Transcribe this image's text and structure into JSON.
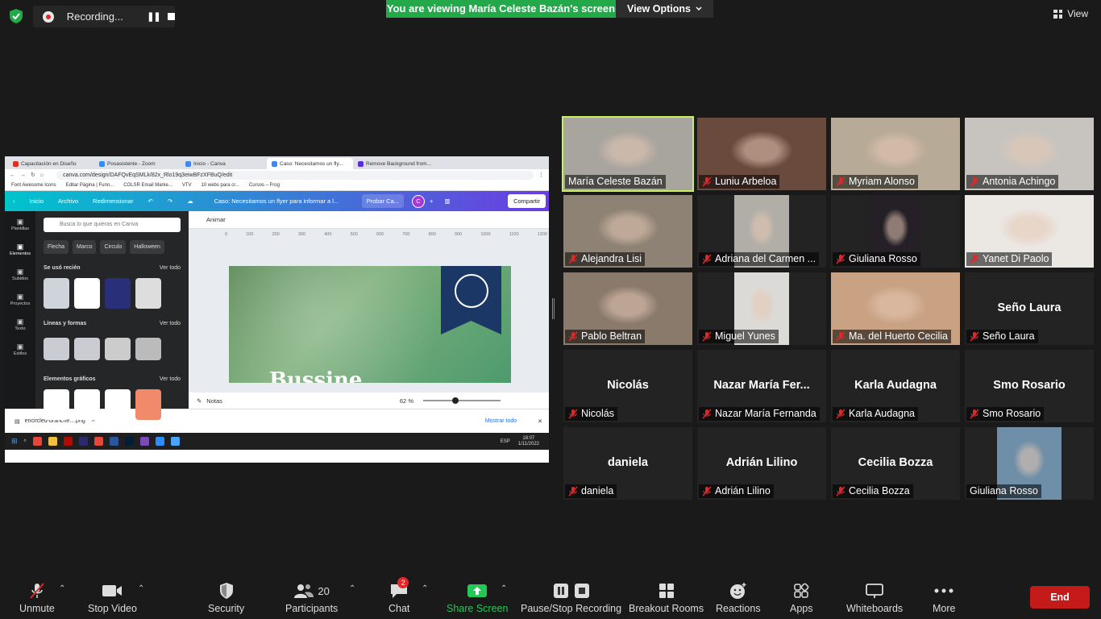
{
  "top_bar": {
    "recording_label": "Recording...",
    "viewing_banner": "You are viewing María Celeste Bazán's screen",
    "view_options_label": "View Options",
    "view_label": "View"
  },
  "shared_screen": {
    "browser_tabs": [
      {
        "label": "Capacitación en Diseño",
        "color": "#d93025"
      },
      {
        "label": "Posasistente - Zoom",
        "color": "#2d8cff"
      },
      {
        "label": "Inicio - Canva",
        "color": "#4285f4"
      },
      {
        "label": "Caso: Necesitamos un fly...",
        "color": "#4285f4"
      },
      {
        "label": "Remove Background from...",
        "color": "#5b2be0"
      }
    ],
    "url": "canva.com/design/DAFQvEqSMLk/82x_Rlo19q3eiwBFzXFBuQ/edit",
    "bookmarks": [
      "Font Awesome Icons",
      "Editar Página | Funn...",
      "COLSR Email Marke...",
      "VTV",
      "10 webs para cr...",
      "Cursos – Frog"
    ],
    "canva_header": {
      "inicio": "Inicio",
      "archivo": "Archivo",
      "redimensionar": "Redimensionar",
      "design_title": "Caso: Necesitamos un flyer para informar a l...",
      "probar": "Probar Ca...",
      "avatar_letter": "C",
      "compartir": "Compartir"
    },
    "rail_items": [
      "Plantillas",
      "Elementos",
      "Subidos",
      "Proyectos",
      "Texto",
      "Estilos"
    ],
    "panel": {
      "search_placeholder": "Busca lo que quieras en Canva",
      "chips": [
        "Flecha",
        "Marco",
        "Circulo",
        "Halloween"
      ],
      "sections": [
        {
          "title": "Se usó recién",
          "link": "Ver todo"
        },
        {
          "title": "Líneas y formas",
          "link": "Ver todo"
        },
        {
          "title": "Elementos gráficos",
          "link": "Ver todo"
        }
      ]
    },
    "animar": "Animar",
    "ruler_ticks": [
      "0",
      "100",
      "200",
      "300",
      "400",
      "500",
      "600",
      "700",
      "800",
      "900",
      "1000",
      "1100",
      "1200"
    ],
    "flyer_heading": "Bussine...",
    "notes_label": "Notas",
    "zoom_value": "62 %",
    "zoom_fraction": 0.62,
    "download_file": "encircled-branche....png",
    "mostrar_todo": "Mostrar todo",
    "taskbar_lang": "ESP",
    "taskbar_time": "18:07",
    "taskbar_date": "1/11/2022"
  },
  "participants": [
    {
      "name": "María Celeste Bazán",
      "muted": false,
      "video": true,
      "speaking": true,
      "bg": "#a8a49e"
    },
    {
      "name": "Luniu Arbeloa",
      "muted": true,
      "video": true,
      "speaking": false,
      "bg": "#6b4a3e"
    },
    {
      "name": "Myriam Alonso",
      "muted": true,
      "video": true,
      "speaking": false,
      "bg": "#b7aa96"
    },
    {
      "name": "Antonia Achingo",
      "muted": true,
      "video": true,
      "speaking": false,
      "bg": "#c7c4bf"
    },
    {
      "name": "Alejandra Lisi",
      "muted": true,
      "video": true,
      "speaking": false,
      "bg": "#8d8274"
    },
    {
      "name": "Adriana del Carmen ...",
      "muted": true,
      "video": true,
      "speaking": false,
      "bg": "#b1aea8"
    },
    {
      "name": "Giuliana Rosso",
      "muted": true,
      "video": true,
      "speaking": false,
      "bg": "#242026"
    },
    {
      "name": "Yanet Di Paolo",
      "muted": true,
      "video": true,
      "speaking": false,
      "bg": "#ebe7e3"
    },
    {
      "name": "Pablo Beltran",
      "muted": true,
      "video": true,
      "speaking": false,
      "bg": "#8a7a6c"
    },
    {
      "name": "Miguel Yunes",
      "muted": true,
      "video": true,
      "speaking": false,
      "bg": "#dcdad6"
    },
    {
      "name": "Ma. del Huerto Cecilia",
      "muted": true,
      "video": true,
      "speaking": false,
      "bg": "#c8a283"
    },
    {
      "name": "Seño Laura",
      "display": "Seño Laura",
      "muted": true,
      "video": false,
      "speaking": false
    },
    {
      "name": "Nicolás",
      "display": "Nicolás",
      "muted": true,
      "video": false,
      "speaking": false
    },
    {
      "name": "Nazar María Fernanda",
      "display": "Nazar María Fer...",
      "muted": true,
      "video": false,
      "speaking": false
    },
    {
      "name": "Karla Audagna",
      "display": "Karla Audagna",
      "muted": true,
      "video": false,
      "speaking": false
    },
    {
      "name": "Smo Rosario",
      "display": "Smo Rosario",
      "muted": true,
      "video": false,
      "speaking": false
    },
    {
      "name": "daniela",
      "display": "daniela",
      "muted": true,
      "video": false,
      "speaking": false
    },
    {
      "name": "Adrián Lilino",
      "display": "Adrián Lilino",
      "muted": true,
      "video": false,
      "speaking": false
    },
    {
      "name": "Cecilia  Bozza",
      "display": "Cecilia  Bozza",
      "muted": true,
      "video": false,
      "speaking": false
    },
    {
      "name": "Giuliana Rosso",
      "muted": false,
      "video": true,
      "speaking": false,
      "bg": "#6f8fa8"
    }
  ],
  "toolbar": {
    "unmute": "Unmute",
    "stop_video": "Stop Video",
    "security": "Security",
    "participants": "Participants",
    "participants_count": "20",
    "chat": "Chat",
    "chat_badge": "2",
    "share_screen": "Share Screen",
    "pause_stop_recording": "Pause/Stop Recording",
    "breakout_rooms": "Breakout Rooms",
    "reactions": "Reactions",
    "apps": "Apps",
    "whiteboards": "Whiteboards",
    "more": "More",
    "end": "End"
  },
  "colors": {
    "speaking_outline": "#c6f060",
    "viewing_banner": "#23a94a",
    "end_button": "#c41a1a",
    "mute_red": "#e02828"
  }
}
